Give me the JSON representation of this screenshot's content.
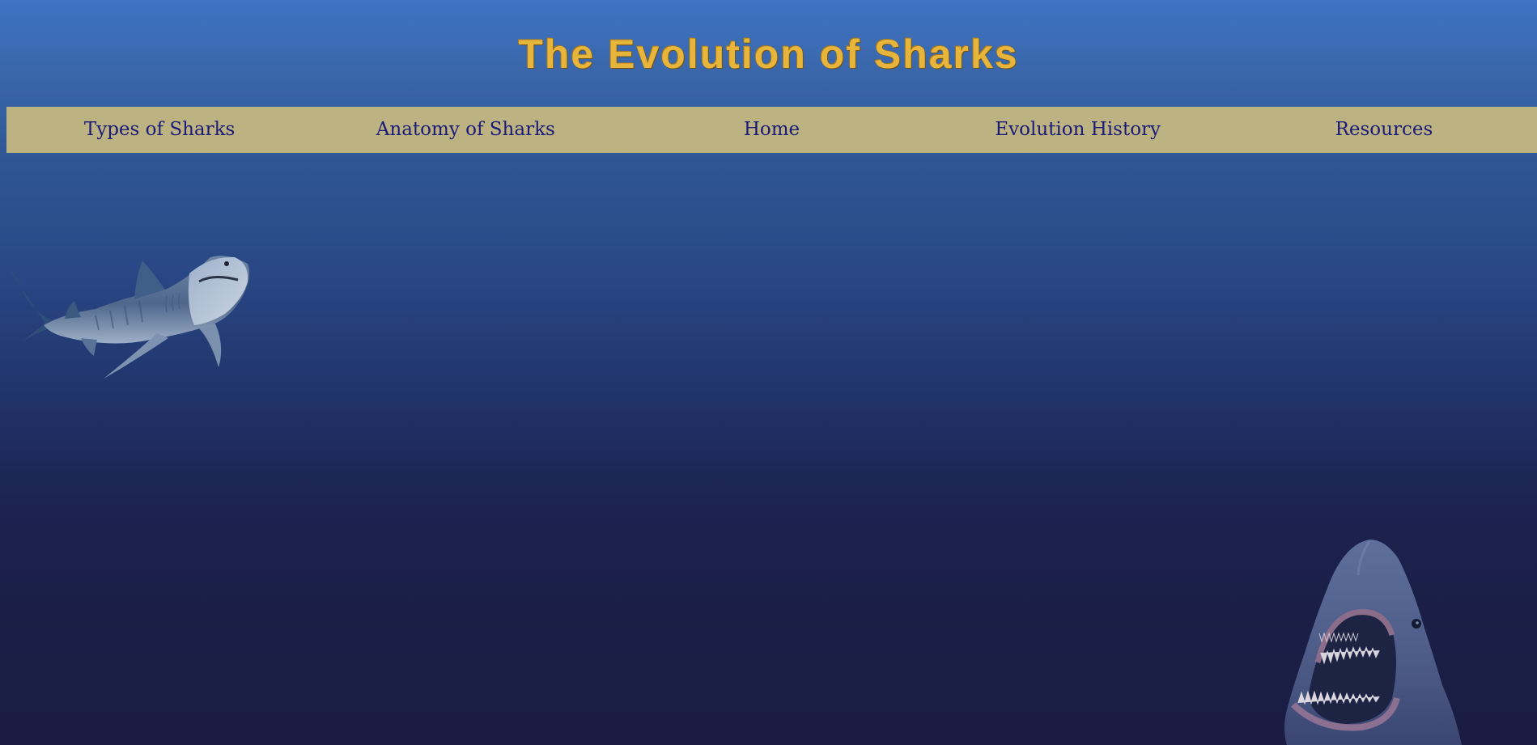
{
  "header": {
    "title": "The Evolution of Sharks"
  },
  "nav": {
    "items": [
      {
        "label": "Types of Sharks"
      },
      {
        "label": "Anatomy of Sharks"
      },
      {
        "label": "Home"
      },
      {
        "label": "Evolution History"
      },
      {
        "label": "Resources"
      }
    ]
  },
  "images": {
    "left_shark": "tiger-shark-image",
    "right_shark": "great-white-shark-image"
  },
  "colors": {
    "title": "#e7b43c",
    "nav_background": "#bdb281",
    "nav_text": "#1a1b78",
    "background_top": "#3d74c4",
    "background_bottom": "#1a1c42"
  }
}
